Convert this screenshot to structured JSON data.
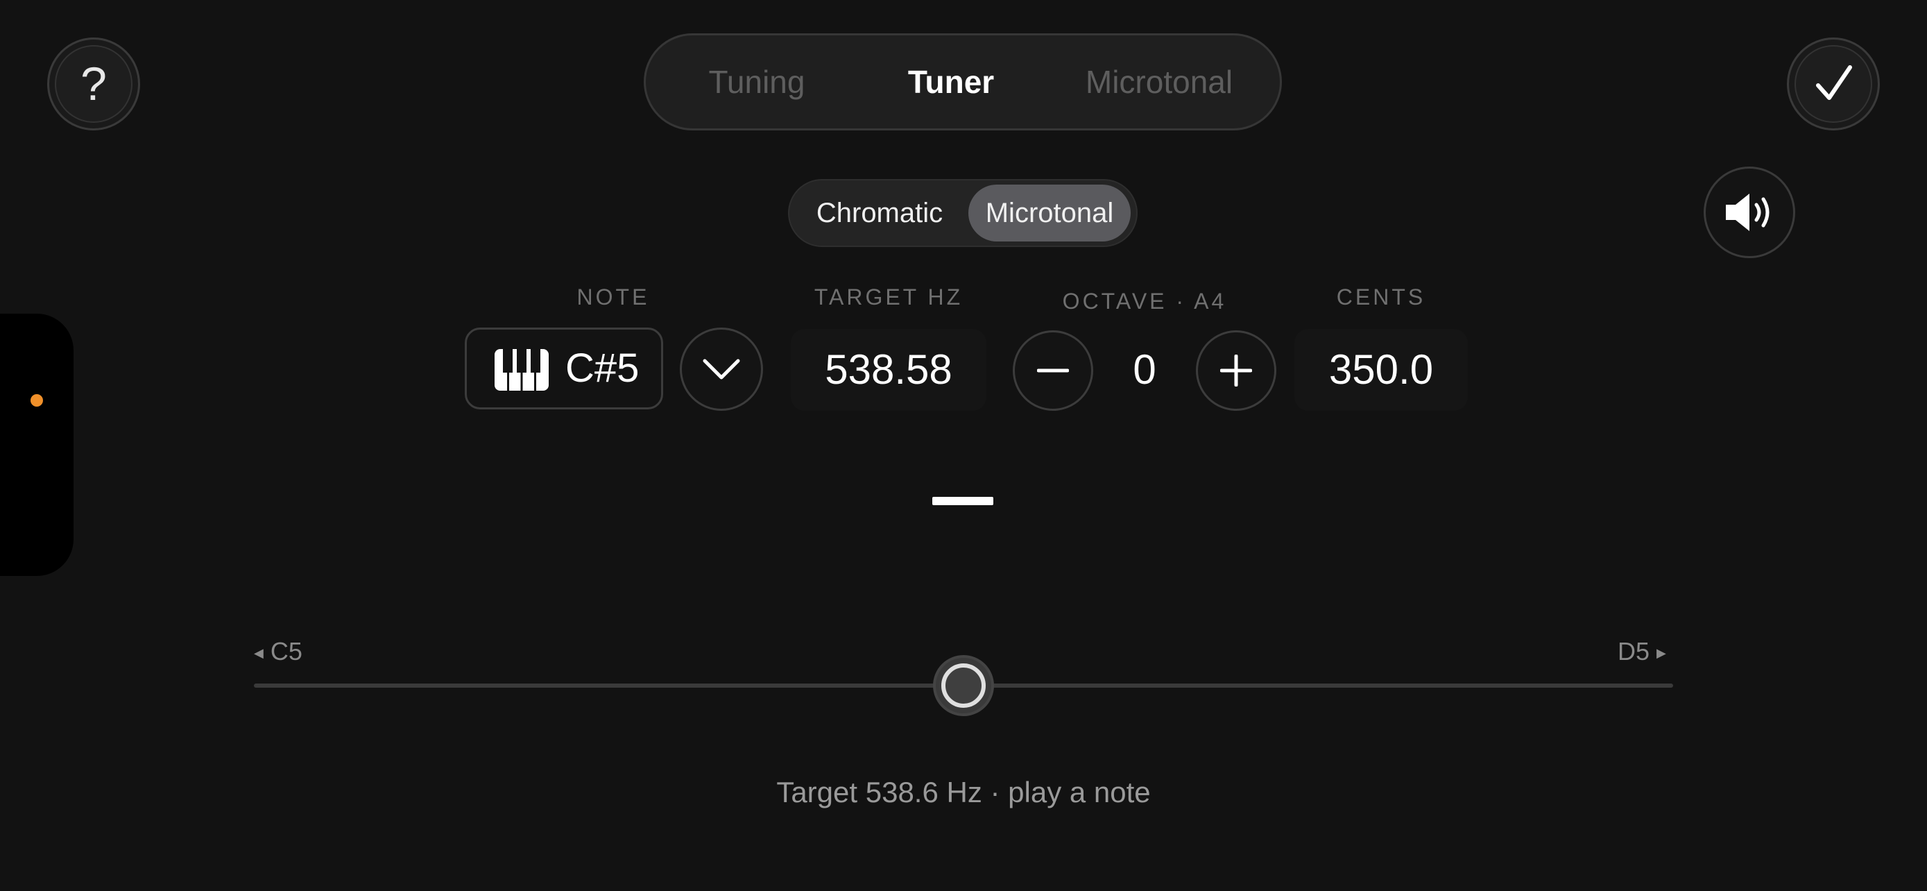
{
  "header": {
    "help_label": "?",
    "tabs": [
      "Tuning",
      "Tuner",
      "Microtonal"
    ],
    "active_tab": "Tuner"
  },
  "mode": {
    "options": [
      "Chromatic",
      "Microtonal"
    ],
    "selected": "Microtonal"
  },
  "fields": {
    "note_label": "NOTE",
    "note_value": "C#5",
    "target_label": "TARGET HZ",
    "target_value": "538.58",
    "octave_label": "OCTAVE · A4",
    "octave_value": "0",
    "cents_label": "CENTS",
    "cents_value": "350.0"
  },
  "slider": {
    "left_label": "C5",
    "right_label": "D5",
    "position_fraction": 0.5
  },
  "status": {
    "text": "Target 538.6 Hz · play a note"
  },
  "icons": [
    "question-mark-icon",
    "checkmark-icon",
    "speaker-icon",
    "piano-icon",
    "chevron-down-icon",
    "minus-icon",
    "plus-icon"
  ],
  "colors": {
    "background": "#121212",
    "accent_dot": "#f0902a",
    "selected_segment": "#5a5a5e"
  }
}
